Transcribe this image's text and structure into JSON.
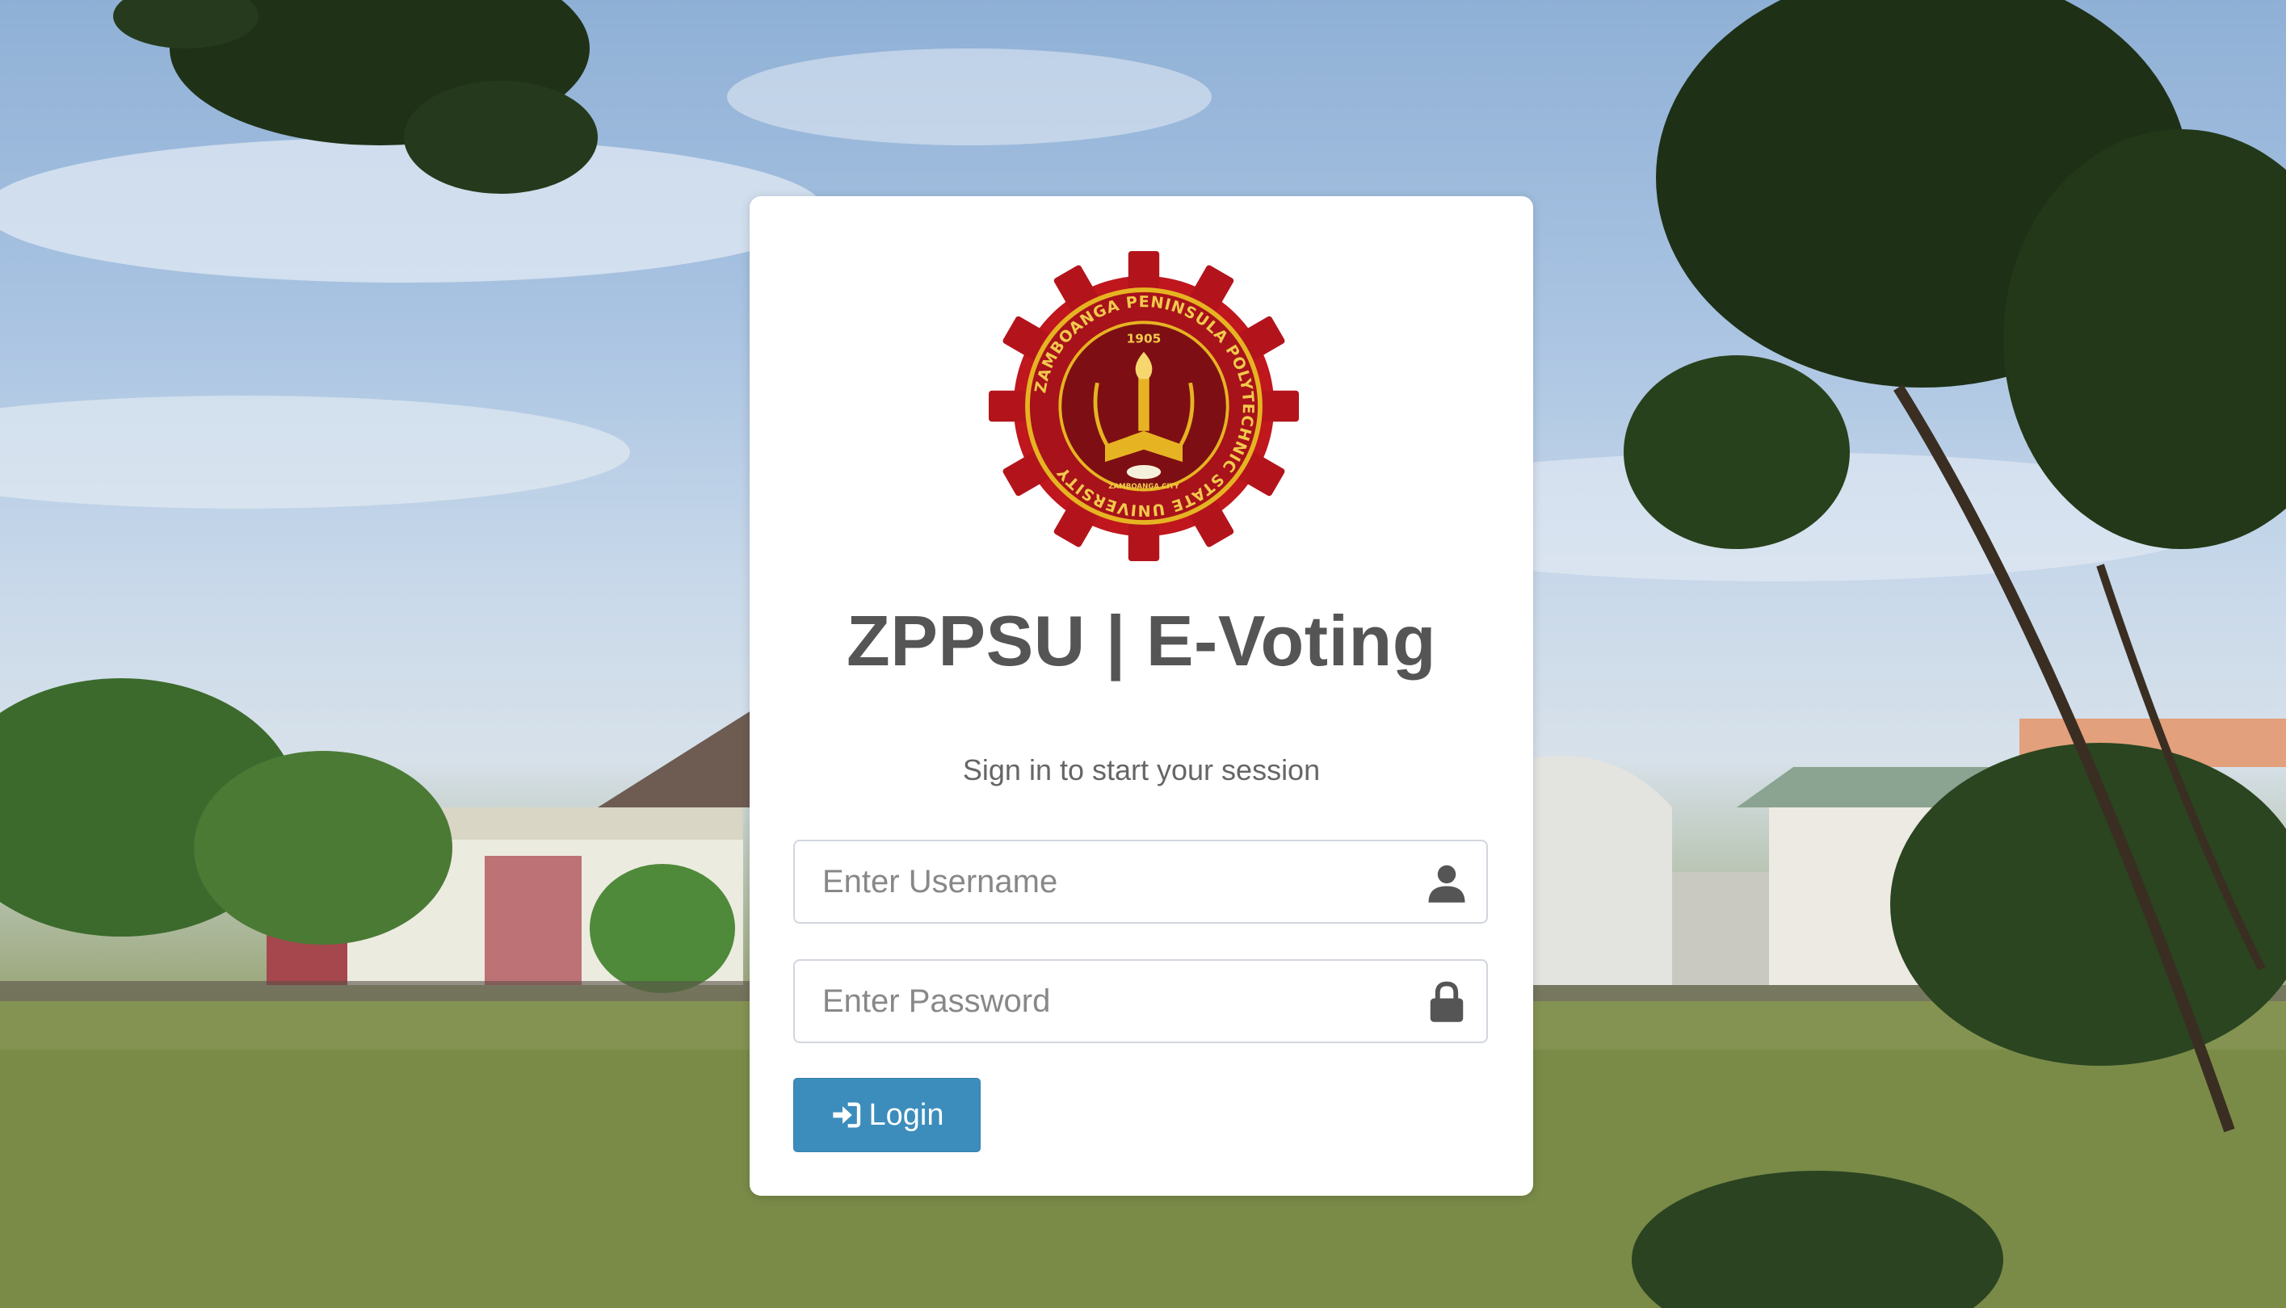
{
  "page": {
    "title": "ZPPSU | E-Voting",
    "subtitle": "Sign in to start your session"
  },
  "seal": {
    "ring_text": "ZAMBOANGA PENINSULA POLYTECHNIC STATE UNIVERSITY",
    "year": "1905",
    "city": "ZAMBOANGA CITY"
  },
  "form": {
    "username_placeholder": "Enter Username",
    "password_placeholder": "Enter Password",
    "login_label": "Login"
  },
  "icons": {
    "username": "user-icon",
    "password": "lock-icon",
    "login": "sign-in-icon"
  },
  "colors": {
    "primary": "#3c8dbc",
    "seal_red": "#b3141b",
    "seal_gold": "#e6b422"
  }
}
